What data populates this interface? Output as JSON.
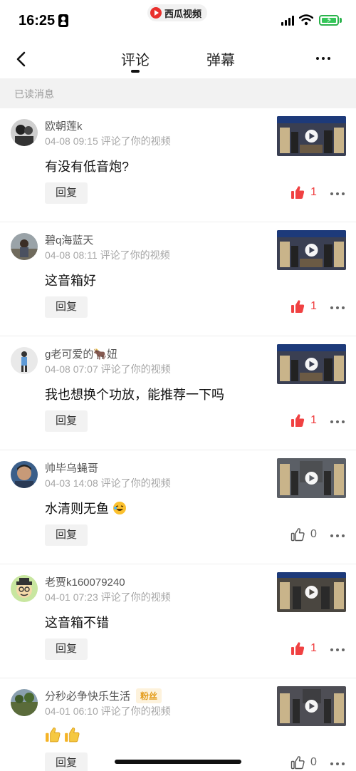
{
  "status_bar": {
    "time": "16:25"
  },
  "app_pill": {
    "name": "西瓜视频"
  },
  "nav": {
    "tabs": [
      {
        "label": "评论",
        "active": true
      },
      {
        "label": "弹幕",
        "active": false
      }
    ]
  },
  "section": {
    "label": "已读消息"
  },
  "colors": {
    "like_active": "#f04142",
    "like_inactive": "#666666",
    "accent_red": "#e9302d",
    "fan_badge": "#e39a17"
  },
  "items": [
    {
      "username": "欧朝莲k",
      "fan_badge": "",
      "meta": "04-08 09:15 评论了你的视频",
      "comment": "有没有低音炮?",
      "reply_label": "回复",
      "likes": "1",
      "liked": true,
      "avatar_icon": "person-avatar",
      "thumb_icon": "video-thumbnail"
    },
    {
      "username": "碧q海蓝天",
      "fan_badge": "",
      "meta": "04-08 08:11 评论了你的视频",
      "comment": "这音箱好",
      "reply_label": "回复",
      "likes": "1",
      "liked": true,
      "avatar_icon": "person-avatar",
      "thumb_icon": "video-thumbnail"
    },
    {
      "username": "g老可爱的🐂妞",
      "fan_badge": "",
      "meta": "04-08 07:07 评论了你的视频",
      "comment": "我也想换个功放，能推荐一下吗",
      "reply_label": "回复",
      "likes": "1",
      "liked": true,
      "avatar_icon": "person-avatar",
      "thumb_icon": "video-thumbnail"
    },
    {
      "username": "帅毕乌蝇哥",
      "fan_badge": "",
      "meta": "04-03 14:08 评论了你的视频",
      "comment": "水清则无鱼",
      "comment_emoji": "laughing-emoji",
      "reply_label": "回复",
      "likes": "0",
      "liked": false,
      "avatar_icon": "person-avatar",
      "thumb_icon": "video-thumbnail"
    },
    {
      "username": "老贾k160079240",
      "fan_badge": "",
      "meta": "04-01 07:23 评论了你的视频",
      "comment": "这音箱不错",
      "reply_label": "回复",
      "likes": "1",
      "liked": true,
      "avatar_icon": "cartoon-avatar",
      "thumb_icon": "video-thumbnail"
    },
    {
      "username": "分秒必争快乐生活",
      "fan_badge": "粉丝",
      "meta": "04-01 06:10 评论了你的视频",
      "comment": "",
      "comment_emoji": "thumbs-up-emoji",
      "reply_label": "回复",
      "likes": "0",
      "liked": false,
      "avatar_icon": "person-avatar",
      "thumb_icon": "video-thumbnail"
    }
  ]
}
